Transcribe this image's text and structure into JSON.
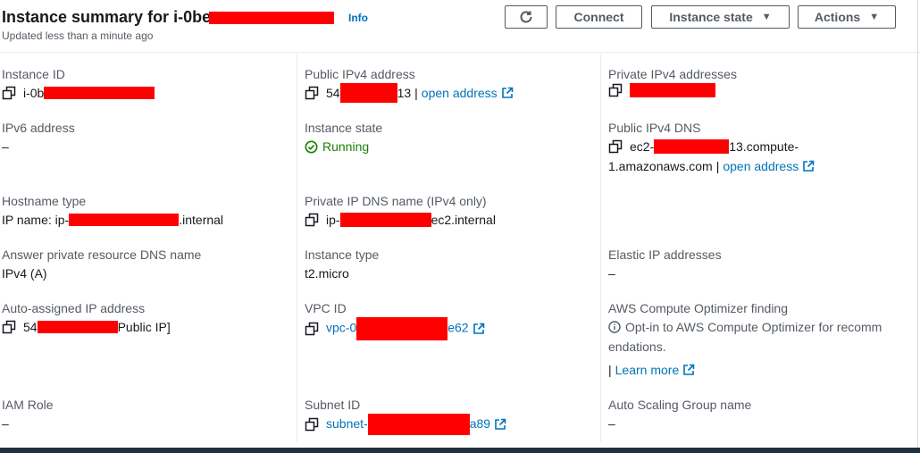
{
  "header": {
    "title": "Instance summary for i-0be",
    "info": "Info",
    "subtitle": "Updated less than a minute ago",
    "buttons": {
      "refresh_icon": "refresh-icon",
      "connect": "Connect",
      "instance_state": "Instance state",
      "actions": "Actions"
    }
  },
  "fields": {
    "instance_id": {
      "label": "Instance ID",
      "prefix": "i-0b"
    },
    "public_ipv4": {
      "label": "Public IPv4 address",
      "prefix": "54",
      "suffix": "13",
      "separator": "|",
      "link": "open address"
    },
    "private_ipv4": {
      "label": "Private IPv4 addresses"
    },
    "ipv6": {
      "label": "IPv6 address",
      "value": "–"
    },
    "instance_state": {
      "label": "Instance state",
      "value": "Running"
    },
    "public_dns": {
      "label": "Public IPv4 DNS",
      "prefix": "ec2-",
      "suffix": "13.compute-",
      "line2": "1.amazonaws.com",
      "separator": "|",
      "link": "open address"
    },
    "hostname_type": {
      "label": "Hostname type",
      "prefix": "IP name: ip-",
      "suffix": ".internal"
    },
    "private_dns": {
      "label": "Private IP DNS name (IPv4 only)",
      "prefix": "ip-",
      "suffix": "ec2.internal"
    },
    "answer_dns": {
      "label": "Answer private resource DNS name",
      "value": "IPv4 (A)"
    },
    "instance_type": {
      "label": "Instance type",
      "value": "t2.micro"
    },
    "elastic_ip": {
      "label": "Elastic IP addresses",
      "value": "–"
    },
    "auto_ip": {
      "label": "Auto-assigned IP address",
      "prefix": "54",
      "suffix": "Public IP]"
    },
    "vpc_id": {
      "label": "VPC ID",
      "prefix": "vpc-0",
      "suffix": "e62"
    },
    "optimizer": {
      "label": "AWS Compute Optimizer finding",
      "text": "Opt-in to AWS Compute Optimizer for recomm endations.",
      "separator": "|",
      "link": "Learn more"
    },
    "iam_role": {
      "label": "IAM Role",
      "value": "–"
    },
    "subnet_id": {
      "label": "Subnet ID",
      "prefix": "subnet-",
      "suffix": "a89"
    },
    "asg_name": {
      "label": "Auto Scaling Group name",
      "value": "–"
    }
  },
  "colors": {
    "link": "#0073bb",
    "running": "#1d8102",
    "label": "#545b64",
    "redaction": "#ff0000"
  }
}
